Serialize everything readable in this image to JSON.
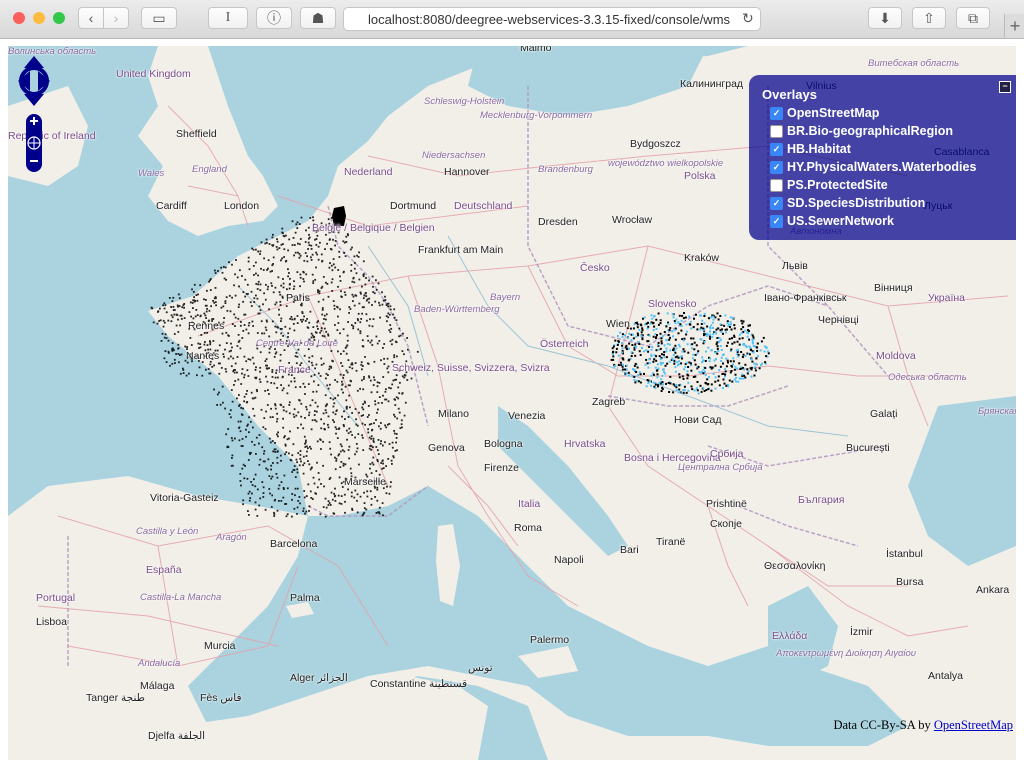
{
  "browser": {
    "url": "localhost:8080/deegree-webservices-3.3.15-fixed/console/wms",
    "buttons": {
      "back": "‹",
      "forward": "›",
      "sidebar": "▭",
      "reader": "I",
      "info": "ⓘ",
      "ghost": "☗",
      "reload": "↻",
      "download": "⬇",
      "share": "⇧",
      "tabs": "⧉",
      "new_tab": "+"
    },
    "traffic_colors": [
      "#fc605c",
      "#fdbc40",
      "#34c84a"
    ]
  },
  "map": {
    "cities": [
      {
        "name": "United Kingdom",
        "kind": "country"
      },
      {
        "name": "Sheffield",
        "kind": "city"
      },
      {
        "name": "Wales",
        "kind": "region"
      },
      {
        "name": "England",
        "kind": "region"
      },
      {
        "name": "Cardiff",
        "kind": "city"
      },
      {
        "name": "London",
        "kind": "city"
      },
      {
        "name": "Republic of Ireland",
        "kind": "country"
      },
      {
        "name": "Malmö",
        "kind": "city"
      },
      {
        "name": "Калининград",
        "kind": "city"
      },
      {
        "name": "Vilnius",
        "kind": "city"
      },
      {
        "name": "Витебская область",
        "kind": "region"
      },
      {
        "name": "Schleswig-Holstein",
        "kind": "region"
      },
      {
        "name": "Mecklenburg-Vorpommern",
        "kind": "region"
      },
      {
        "name": "Bydgoszcz",
        "kind": "city"
      },
      {
        "name": "Niedersachsen",
        "kind": "region"
      },
      {
        "name": "Nederland",
        "kind": "country"
      },
      {
        "name": "Hannover",
        "kind": "city"
      },
      {
        "name": "Brandenburg",
        "kind": "region"
      },
      {
        "name": "województwo wielkopolskie",
        "kind": "region"
      },
      {
        "name": "Polska",
        "kind": "country"
      },
      {
        "name": "Dortmund",
        "kind": "city"
      },
      {
        "name": "Deutschland",
        "kind": "country"
      },
      {
        "name": "Dresden",
        "kind": "city"
      },
      {
        "name": "Wrocław",
        "kind": "city"
      },
      {
        "name": "België / Belgique / Belgien",
        "kind": "country"
      },
      {
        "name": "Frankfurt am Main",
        "kind": "city"
      },
      {
        "name": "Česko",
        "kind": "country"
      },
      {
        "name": "Kraków",
        "kind": "city"
      },
      {
        "name": "Львів",
        "kind": "city"
      },
      {
        "name": "Bayern",
        "kind": "region"
      },
      {
        "name": "Baden-Württemberg",
        "kind": "region"
      },
      {
        "name": "Slovensko",
        "kind": "country"
      },
      {
        "name": "Івано-Франківськ",
        "kind": "city"
      },
      {
        "name": "Вінниця",
        "kind": "city"
      },
      {
        "name": "Україна",
        "kind": "country"
      },
      {
        "name": "Rennes",
        "kind": "city"
      },
      {
        "name": "Paris",
        "kind": "city"
      },
      {
        "name": "Wien",
        "kind": "city"
      },
      {
        "name": "Чернівці",
        "kind": "city"
      },
      {
        "name": "Nantes",
        "kind": "city"
      },
      {
        "name": "Centre-Val de Loire",
        "kind": "region"
      },
      {
        "name": "Österreich",
        "kind": "country"
      },
      {
        "name": "Moldova",
        "kind": "country"
      },
      {
        "name": "France",
        "kind": "country"
      },
      {
        "name": "Schweiz, Suisse, Svizzera, Svizra",
        "kind": "country"
      },
      {
        "name": "Одеська область",
        "kind": "region"
      },
      {
        "name": "Zagreb",
        "kind": "city"
      },
      {
        "name": "Milano",
        "kind": "city"
      },
      {
        "name": "Venezia",
        "kind": "city"
      },
      {
        "name": "Нови Сад",
        "kind": "city"
      },
      {
        "name": "Galați",
        "kind": "city"
      },
      {
        "name": "Hrvatska",
        "kind": "country"
      },
      {
        "name": "Genova",
        "kind": "city"
      },
      {
        "name": "Bologna",
        "kind": "city"
      },
      {
        "name": "Bosna i Hercegovina",
        "kind": "country"
      },
      {
        "name": "Србија",
        "kind": "country"
      },
      {
        "name": "Централна Србија",
        "kind": "region"
      },
      {
        "name": "București",
        "kind": "city"
      },
      {
        "name": "Firenze",
        "kind": "city"
      },
      {
        "name": "Marseille",
        "kind": "city"
      },
      {
        "name": "Vitoria-Gasteiz",
        "kind": "city"
      },
      {
        "name": "Prishtinë",
        "kind": "city"
      },
      {
        "name": "България",
        "kind": "country"
      },
      {
        "name": "Italia",
        "kind": "country"
      },
      {
        "name": "Castilla y León",
        "kind": "region"
      },
      {
        "name": "Aragón",
        "kind": "region"
      },
      {
        "name": "Roma",
        "kind": "city"
      },
      {
        "name": "Скопје",
        "kind": "city"
      },
      {
        "name": "Barcelona",
        "kind": "city"
      },
      {
        "name": "Bari",
        "kind": "city"
      },
      {
        "name": "Tiranë",
        "kind": "city"
      },
      {
        "name": "Napoli",
        "kind": "city"
      },
      {
        "name": "España",
        "kind": "country"
      },
      {
        "name": "Θεσσαλονίκη",
        "kind": "city"
      },
      {
        "name": "İstanbul",
        "kind": "city"
      },
      {
        "name": "Portugal",
        "kind": "country"
      },
      {
        "name": "Castilla-La Mancha",
        "kind": "region"
      },
      {
        "name": "Palma",
        "kind": "city"
      },
      {
        "name": "Bursa",
        "kind": "city"
      },
      {
        "name": "Ankara",
        "kind": "city"
      },
      {
        "name": "Lisboa",
        "kind": "city"
      },
      {
        "name": "Ελλάδα",
        "kind": "country"
      },
      {
        "name": "İzmir",
        "kind": "city"
      },
      {
        "name": "Murcia",
        "kind": "city"
      },
      {
        "name": "Palermo",
        "kind": "city"
      },
      {
        "name": "Αποκεντρωμένη Διοίκηση Αιγαίου",
        "kind": "region"
      },
      {
        "name": "Andalucía",
        "kind": "region"
      },
      {
        "name": "Málaga",
        "kind": "city"
      },
      {
        "name": "تونس",
        "kind": "city"
      },
      {
        "name": "Antalya",
        "kind": "city"
      },
      {
        "name": "Alger الجزائر",
        "kind": "city"
      },
      {
        "name": "Constantine قسنطينة",
        "kind": "city"
      },
      {
        "name": "Tanger طنجة",
        "kind": "city"
      },
      {
        "name": "Fès فاس",
        "kind": "city"
      },
      {
        "name": "Djelfa الجلفة",
        "kind": "city"
      },
      {
        "name": "Casablanca",
        "kind": "city"
      },
      {
        "name": "Брянская область",
        "kind": "region"
      },
      {
        "name": "Автономна",
        "kind": "region"
      },
      {
        "name": "Луцьк",
        "kind": "city"
      },
      {
        "name": "Волинська область",
        "kind": "region"
      }
    ]
  },
  "controls": {
    "pan_up": "▲",
    "pan_down": "▼",
    "pan_left": "◀",
    "pan_right": "▶",
    "zoom_in": "+",
    "zoom_world": "⊕",
    "zoom_out": "−"
  },
  "overlays": {
    "title": "Overlays",
    "minimize": "−",
    "layers": [
      {
        "name": "OpenStreetMap",
        "checked": true
      },
      {
        "name": "BR.Bio-geographicalRegion",
        "checked": false
      },
      {
        "name": "HB.Habitat",
        "checked": true
      },
      {
        "name": "HY.PhysicalWaters.Waterbodies",
        "checked": true
      },
      {
        "name": "PS.ProtectedSite",
        "checked": false
      },
      {
        "name": "SD.SpeciesDistribution",
        "checked": true
      },
      {
        "name": "US.SewerNetwork",
        "checked": true
      }
    ]
  },
  "attribution": {
    "text": "Data CC-By-SA by",
    "link": "OpenStreetMap"
  }
}
